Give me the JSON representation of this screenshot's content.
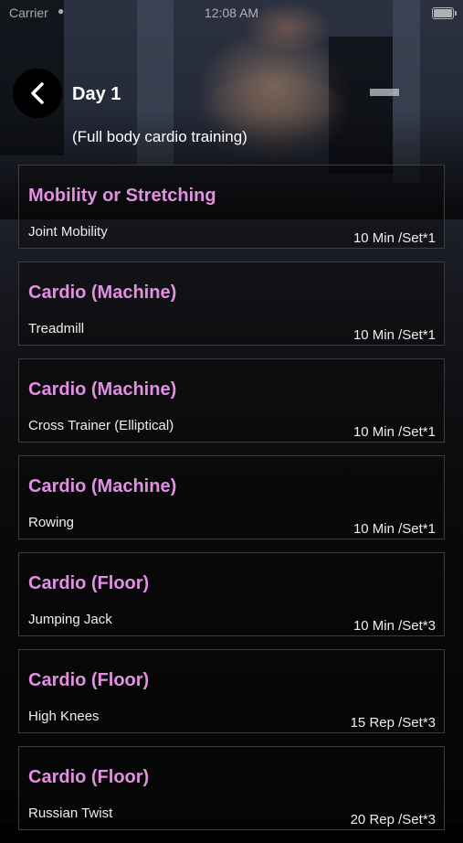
{
  "status_bar": {
    "carrier": "Carrier",
    "time": "12:08 AM"
  },
  "header": {
    "title": "Day 1",
    "subtitle": "(Full body cardio training)",
    "back_icon": "chevron-left-icon"
  },
  "exercises": [
    {
      "category": "Mobility or Stretching",
      "name": "Joint Mobility",
      "meta": "10 Min /Set*1"
    },
    {
      "category": "Cardio (Machine)",
      "name": "Treadmill",
      "meta": "10 Min /Set*1"
    },
    {
      "category": "Cardio (Machine)",
      "name": "Cross Trainer (Elliptical)",
      "meta": "10 Min /Set*1"
    },
    {
      "category": "Cardio (Machine)",
      "name": "Rowing",
      "meta": "10 Min /Set*1"
    },
    {
      "category": "Cardio (Floor)",
      "name": "Jumping Jack",
      "meta": "10 Min /Set*3"
    },
    {
      "category": "Cardio (Floor)",
      "name": "High Knees",
      "meta": "15 Rep /Set*3"
    },
    {
      "category": "Cardio (Floor)",
      "name": "Russian Twist",
      "meta": "20 Rep /Set*3"
    }
  ],
  "colors": {
    "category_text": "#e38fe3",
    "card_border": "#3d3d40",
    "background": "#000000"
  }
}
